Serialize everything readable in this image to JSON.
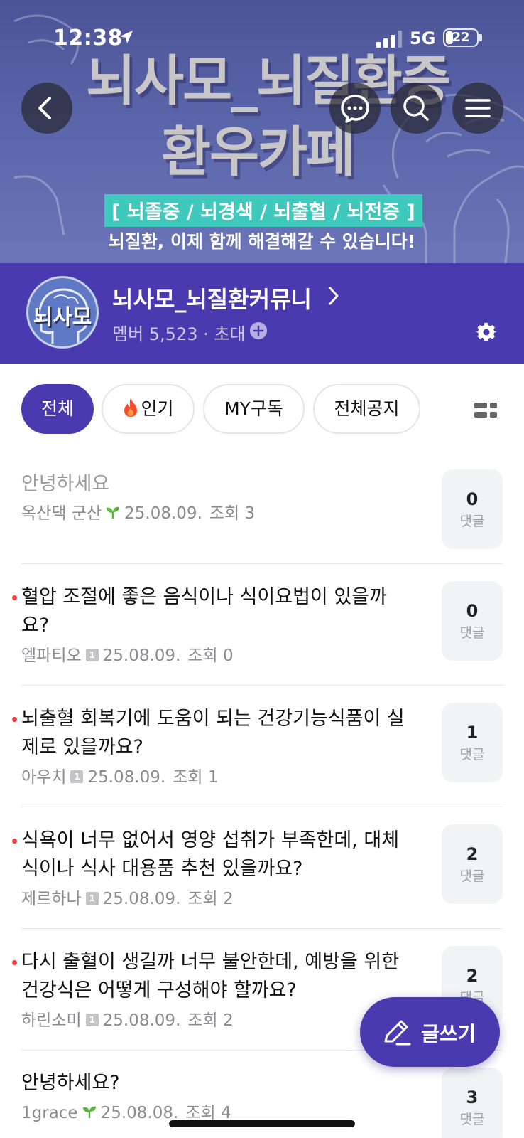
{
  "status_bar": {
    "time": "12:38",
    "network": "5G",
    "battery": "22"
  },
  "banner": {
    "title_line1": "뇌사모_뇌질환증",
    "title_line2": "환우카페",
    "tags": "[ 뇌졸중 / 뇌경색 / 뇌출혈 / 뇌전증 ]",
    "subtitle": "뇌질환, 이제 함께 해결해갈 수 있습니다!"
  },
  "header_buttons": {
    "back": "back-icon",
    "chat": "chat-icon",
    "search": "search-icon",
    "menu": "menu-icon"
  },
  "cafe": {
    "logo_text": "뇌사모",
    "name": "뇌사모_뇌질환커뮤니",
    "members": "멤버 5,523 · 초대"
  },
  "tabs": [
    {
      "label": "전체",
      "active": true
    },
    {
      "label": "인기",
      "active": false
    },
    {
      "label": "MY구독",
      "active": false
    },
    {
      "label": "전체공지",
      "active": false
    }
  ],
  "posts": [
    {
      "title_l1": "안녕하세요",
      "title_l2": "",
      "author": "옥산댁 군산",
      "badge": "sprout",
      "date": "25.08.09.",
      "views": "조회 3",
      "comments": "0",
      "comment_label": "댓글",
      "is_new": false,
      "read": true
    },
    {
      "title_l1": "혈압 조절에 좋은 음식이나 식이요법이 있을까",
      "title_l2": "요?",
      "author": "엘파티오",
      "badge": "1",
      "date": "25.08.09.",
      "views": "조회 0",
      "comments": "0",
      "comment_label": "댓글",
      "is_new": true,
      "read": false
    },
    {
      "title_l1": "뇌출혈 회복기에 도움이 되는 건강기능식품이 실",
      "title_l2": "제로 있을까요?",
      "author": "아우치",
      "badge": "1",
      "date": "25.08.09.",
      "views": "조회 1",
      "comments": "1",
      "comment_label": "댓글",
      "is_new": true,
      "read": false
    },
    {
      "title_l1": "식욕이 너무 없어서 영양 섭취가 부족한데, 대체",
      "title_l2": "식이나 식사 대용품 추천 있을까요?",
      "author": "제르하나",
      "badge": "1",
      "date": "25.08.09.",
      "views": "조회 2",
      "comments": "2",
      "comment_label": "댓글",
      "is_new": true,
      "read": false
    },
    {
      "title_l1": "다시 출혈이 생길까 너무 불안한데, 예방을 위한",
      "title_l2": "건강식은 어떻게 구성해야 할까요?",
      "author": "하린소미",
      "badge": "1",
      "date": "25.08.09.",
      "views": "조회 2",
      "comments": "2",
      "comment_label": "댓글",
      "is_new": true,
      "read": false
    },
    {
      "title_l1": "안녕하세요?",
      "title_l2": "",
      "author": "1grace",
      "badge": "sprout",
      "date": "25.08.08.",
      "views": "조회 4",
      "comments": "3",
      "comment_label": "댓글",
      "is_new": false,
      "read": false
    }
  ],
  "write_button": {
    "label": "글쓰기"
  },
  "colors": {
    "brand": "#4a3ab0",
    "tag": "#3fc9bd",
    "new_dot": "#ff3b3b",
    "sprout": "#5cb33a"
  }
}
